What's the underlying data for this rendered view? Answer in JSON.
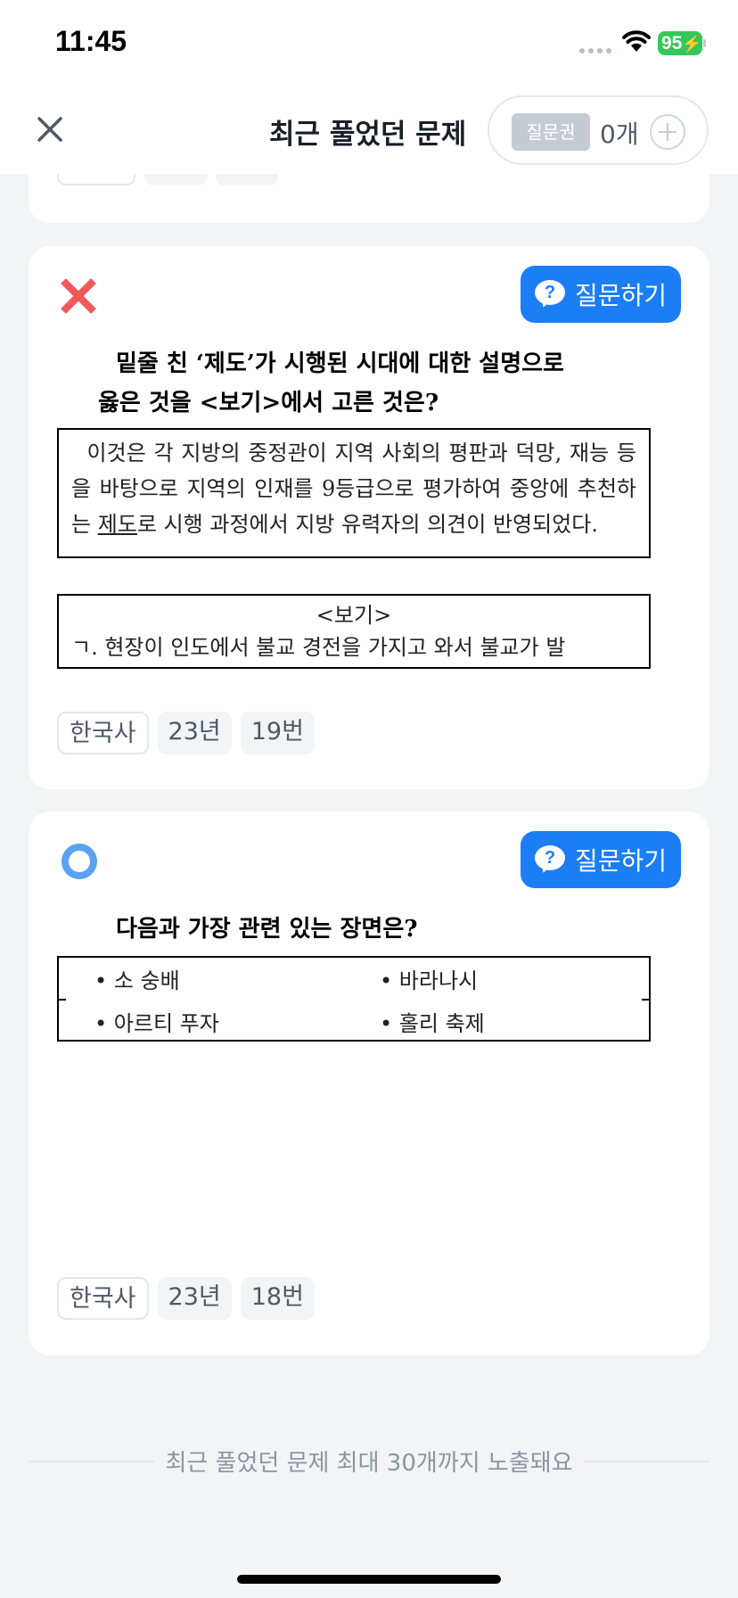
{
  "status_bar": {
    "time": "11:45",
    "battery": "95"
  },
  "header": {
    "title": "최근 풀었던 문제",
    "ticket_label": "질문권",
    "ticket_count": "0개"
  },
  "cards": [
    {
      "result": "wrong",
      "ask_label": "질문하기",
      "question_line1": "밑줄 친 ‘제도’가 시행된 시대에 대한 설명으로",
      "question_line2": "옳은 것을 <보기>에서 고른 것은?",
      "passage_before": "이것은 각 지방의 중정관이 지역 사회의 평판과 덕망, 재능 등을 바탕으로 지역의 인재를 9등급으로 평가하여 중앙에 추천하는 ",
      "passage_underlined": "제도",
      "passage_after": "로 시행 과정에서 지방 유력자의 의견이 반영되었다.",
      "bogi_title": "<보기>",
      "bogi_first_line": "ㄱ. 현장이 인도에서 불교 경전을 가지고 와서 불교가 발",
      "tags": [
        "한국사",
        "23년",
        "19번"
      ]
    },
    {
      "result": "correct",
      "ask_label": "질문하기",
      "question": "다음과 가장 관련 있는 장면은?",
      "items": [
        "• 소 숭배",
        "• 바라나시",
        "• 아르티 푸자",
        "• 홀리 축제"
      ],
      "tags": [
        "한국사",
        "23년",
        "18번"
      ]
    }
  ],
  "footer_note": "최근 풀었던 문제 최대 30개까지 노출돼요",
  "colors": {
    "accent": "#1b7ef5",
    "wrong": "#f0585a",
    "correct": "#5aa2f0",
    "battery": "#34c759"
  }
}
